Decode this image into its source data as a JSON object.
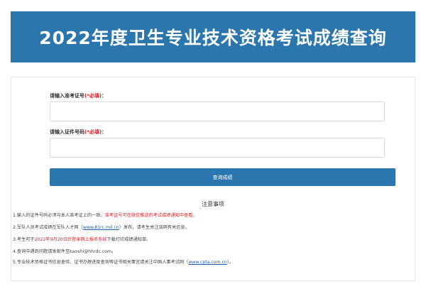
{
  "banner": {
    "title": "2022年度卫生专业技术资格考试成绩查询",
    "bg_color": "#2b76ad"
  },
  "form": {
    "ticket": {
      "label": "请输入准考证号",
      "required_mark": "(*必填)",
      "colon": "：",
      "value": ""
    },
    "id_number": {
      "label": "请输入证件号码",
      "required_mark": "(*必填)",
      "colon": "：",
      "value": ""
    },
    "query_button": "查询成绩"
  },
  "notice": {
    "title": "注意事项",
    "line1": {
      "text": "1.输入的证件号码必须与本人准考证上的一致。",
      "red": "准考证号可在微信推送的考试成绩通知中查看。"
    },
    "line2": {
      "pre": "2.军队人员考试成绩在军队人才网（",
      "link": "www.81rc.mil.cn",
      "post": "）发布，请考生关注该网有关信息。"
    },
    "line3": {
      "pre": "3.考生可于",
      "red": "2022年9月20日后登录网上报名系统",
      "post": "下载打印成绩通知单。"
    },
    "line4": {
      "text": "4.查询中遇到问题请发邮件至kaoshi@hhrdc.com。"
    },
    "line5": {
      "pre": "5.专业技术资格证书信息查验、证书办理进度查询等证书相关事宜请关注中国人事考试网（",
      "link": "www.cpta.com.cn",
      "post": "）。"
    }
  },
  "colors": {
    "accent": "#2b76ad",
    "required": "#d8232a",
    "link": "#1f5fa8"
  }
}
